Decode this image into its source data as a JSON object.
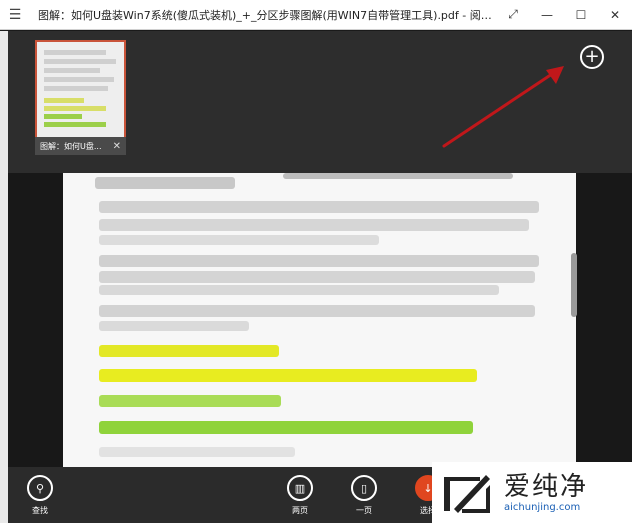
{
  "window": {
    "title": "图解：如何U盘装Win7系统(傻瓜式装机)_+_分区步骤图解(用WIN7自带管理工具).pdf - 阅读器",
    "menu_icon": "hamburger-icon",
    "controls": [
      "expand-icon",
      "minimize-icon",
      "maximize-icon",
      "close-icon"
    ]
  },
  "tabs": {
    "items": [
      {
        "label": "图解：如何U盘...",
        "close": "✕",
        "active": true
      }
    ],
    "add_label": "+"
  },
  "bottom_bar": {
    "find_label": "查找",
    "two_page_label": "两页",
    "one_page_label": "一页",
    "more_label": "选择"
  },
  "watermark": {
    "cn": "爱纯净",
    "url": "aichunjing.com"
  },
  "colors": {
    "accent": "#c9543a",
    "arrow": "#c0171a",
    "highlight_yellow": "#e3e826",
    "highlight_green": "#8fd33b"
  }
}
